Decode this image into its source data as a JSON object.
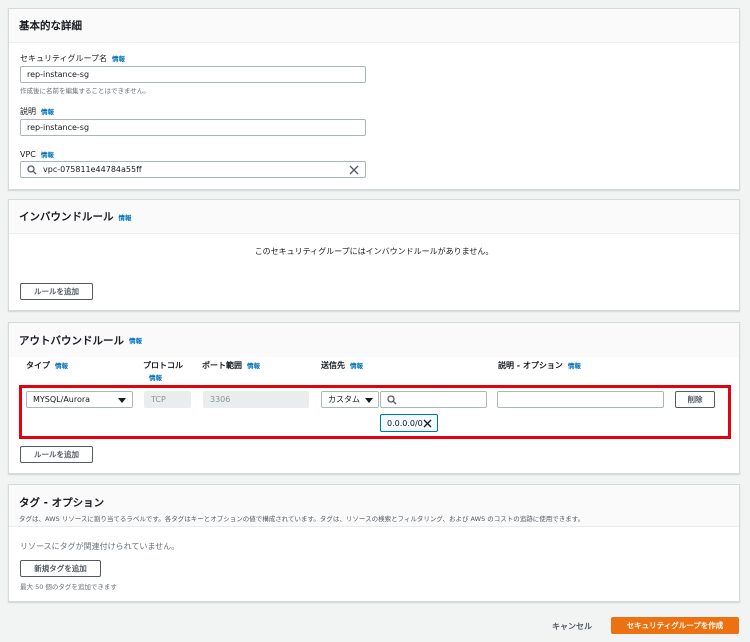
{
  "basic": {
    "title": "基本的な詳細",
    "sg_name_label": "セキュリティグループ名",
    "info": "情報",
    "sg_name_value": "rep-instance-sg",
    "sg_name_hint": "作成後に名前を編集することはできません。",
    "desc_label": "説明",
    "desc_value": "rep-instance-sg",
    "vpc_label": "VPC",
    "vpc_value": "vpc-075811e44784a55ff"
  },
  "inbound": {
    "title": "インバウンドルール",
    "info": "情報",
    "empty": "このセキュリティグループにはインバウンドルールがありません。",
    "add_rule": "ルールを追加"
  },
  "outbound": {
    "title": "アウトバウンドルール",
    "info": "情報",
    "columns": {
      "type": "タイプ",
      "protocol": "プロトコル",
      "port": "ポート範囲",
      "dest": "送信先",
      "desc": "説明 - オプション",
      "info": "情報"
    },
    "rule": {
      "type": "MYSQL/Aurora",
      "protocol": "TCP",
      "port": "3306",
      "dest_mode": "カスタム",
      "dest_search": "",
      "cidr": "0.0.0.0/0",
      "desc": "",
      "delete": "削除"
    },
    "add_rule": "ルールを追加",
    "highlight_color": "#e3020f"
  },
  "tags": {
    "title": "タグ - オプション",
    "description": "タグは、AWS リソースに割り当てるラベルです。各タグはキーとオプションの値で構成されています。タグは、リソースの検索とフィルタリング、および AWS のコストの追跡に使用できます。",
    "empty": "リソースにタグが関連付けられていません。",
    "add_tag": "新規タグを追加",
    "limit": "最大 50 個のタグを追加できます"
  },
  "footer": {
    "cancel": "キャンセル",
    "create": "セキュリティグループを作成",
    "accent": "#ec7211"
  }
}
